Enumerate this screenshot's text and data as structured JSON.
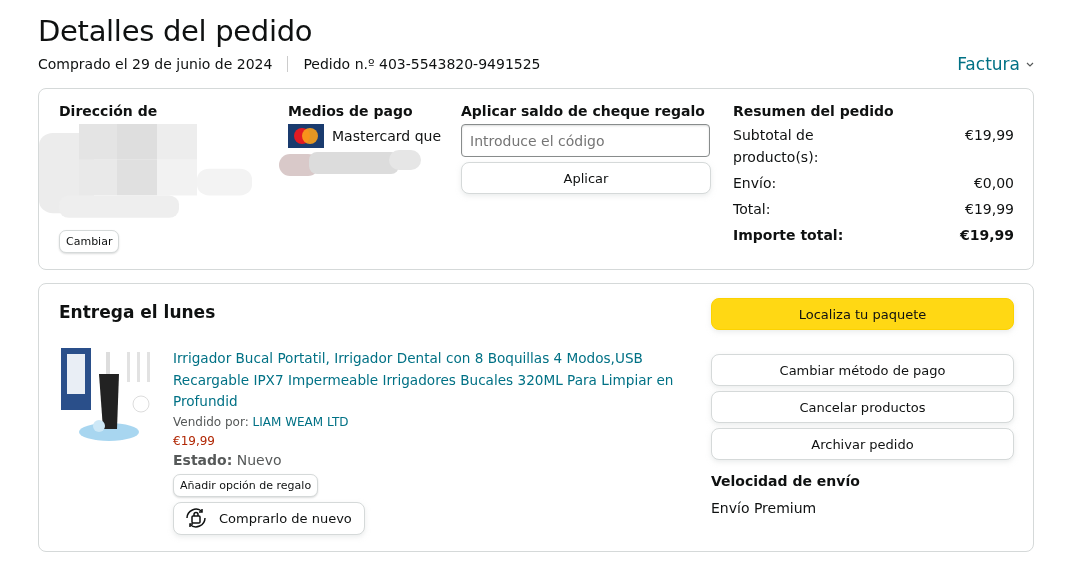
{
  "page": {
    "title": "Detalles del pedido",
    "purchased": "Comprado el 29 de junio de 2024",
    "order_number": "Pedido n.º 403-5543820-9491525",
    "invoice": "Factura"
  },
  "summary_card": {
    "address": {
      "heading": "Dirección de",
      "change_button": "Cambiar"
    },
    "payment": {
      "heading": "Medios de pago",
      "method": "Mastercard que"
    },
    "gift": {
      "heading": "Aplicar saldo de cheque regalo",
      "placeholder": "Introduce el código",
      "apply_button": "Aplicar"
    },
    "order_summary": {
      "heading": "Resumen del pedido",
      "rows": [
        {
          "kind": "line",
          "label": "Subtotal de producto(s):",
          "value": "€19,99"
        },
        {
          "kind": "line",
          "label": "Envío:",
          "value": "€0,00"
        },
        {
          "kind": "line",
          "label": "Total:",
          "value": "€19,99"
        },
        {
          "kind": "total",
          "label": "Importe total:",
          "value": "€19,99"
        }
      ]
    }
  },
  "delivery_card": {
    "heading": "Entrega el lunes",
    "product": {
      "title": "Irrigador Bucal Portatil, Irrigador Dental con 8 Boquillas 4 Modos,USB Recargable IPX7 Impermeable Irrigadores Bucales 320ML Para Limpiar en Profundid",
      "sold_by_label": "Vendido por:",
      "seller": "LIAM WEAM LTD",
      "price": "€19,99",
      "condition": "**Estado:** Nuevo",
      "gift_button": "Añadir opción de regalo",
      "buy_again_button": "Comprarlo de nuevo"
    },
    "actions": [
      {
        "kind": "primary",
        "label": "Localiza tu paquete"
      },
      {
        "kind": "secondary",
        "label": "Cambiar método de pago"
      },
      {
        "kind": "secondary",
        "label": "Cancelar productos"
      },
      {
        "kind": "secondary",
        "label": "Archivar pedido"
      }
    ],
    "shipping": {
      "heading": "Velocidad de envío",
      "value": "Envío Premium"
    }
  }
}
